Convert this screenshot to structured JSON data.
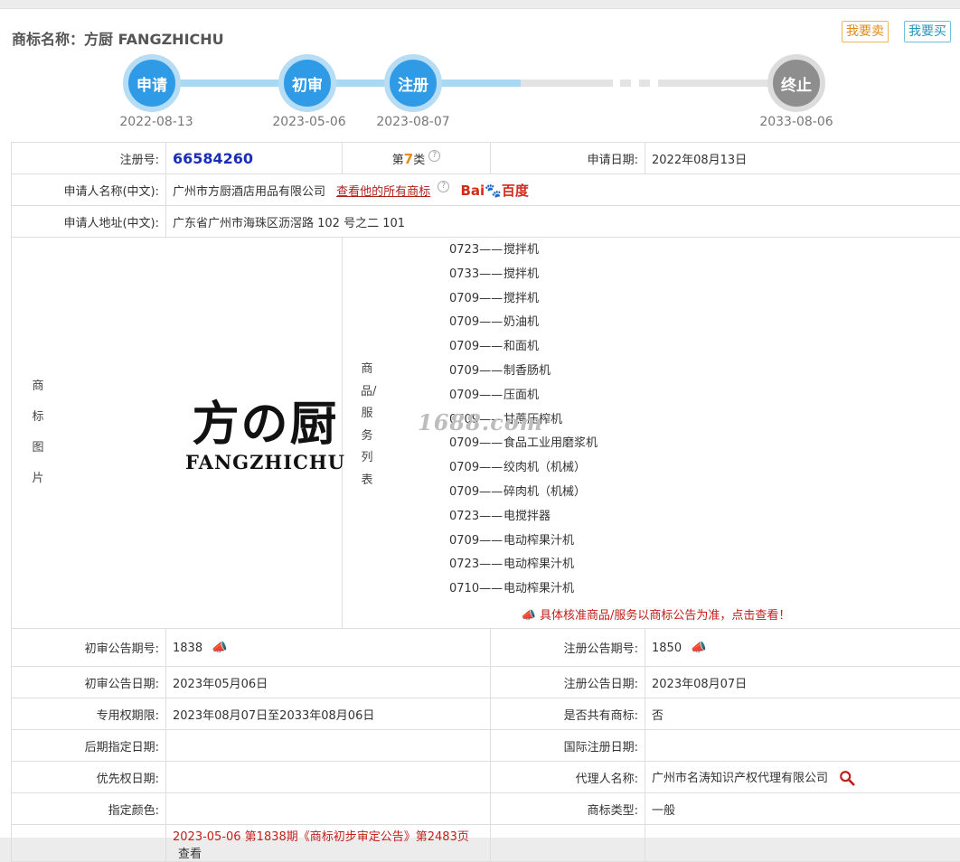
{
  "header": {
    "title": "商标名称：方厨 FANGZHICHU",
    "sell_label": "我要卖",
    "buy_label": "我要买"
  },
  "timeline": [
    {
      "label": "申请",
      "date": "2022-08-13"
    },
    {
      "label": "初审",
      "date": "2023-05-06"
    },
    {
      "label": "注册",
      "date": "2023-08-07"
    },
    {
      "label": "终止",
      "date": "2033-08-06"
    }
  ],
  "info": {
    "reg_no_label": "注册号:",
    "reg_no": "66584260",
    "class_prefix": "第",
    "class_num": "7",
    "class_suffix": "类",
    "apply_date_label": "申请日期:",
    "apply_date": "2022年08月13日",
    "applicant_label": "申请人名称(中文):",
    "applicant": "广州市方厨酒店用品有限公司",
    "view_all_link": "查看他的所有商标",
    "baidu_logo_text": "Bai百度",
    "address_label": "申请人地址(中文):",
    "address": "广东省广州市海珠区沥滘路 102 号之二 101",
    "image_label": "商标图片",
    "logo_cn": "方の厨",
    "logo_en": "FANGZHICHU",
    "watermark": "1688.com",
    "goods_label": "商品/服务列表",
    "goods": [
      {
        "code": "0723——",
        "name": "搅拌机"
      },
      {
        "code": "0733——",
        "name": "搅拌机"
      },
      {
        "code": "0709——",
        "name": "搅拌机"
      },
      {
        "code": "0709——",
        "name": "奶油机"
      },
      {
        "code": "0709——",
        "name": "和面机"
      },
      {
        "code": "0709——",
        "name": "制香肠机"
      },
      {
        "code": "0709——",
        "name": "压面机"
      },
      {
        "code": "0709——",
        "name": "甘蔗压榨机"
      },
      {
        "code": "0709——",
        "name": "食品工业用磨浆机"
      },
      {
        "code": "0709——",
        "name": "绞肉机（机械）"
      },
      {
        "code": "0709——",
        "name": "碎肉机（机械）"
      },
      {
        "code": "0723——",
        "name": "电搅拌器"
      },
      {
        "code": "0709——",
        "name": "电动榨果汁机"
      },
      {
        "code": "0723——",
        "name": "电动榨果汁机"
      },
      {
        "code": "0710——",
        "name": "电动榨果汁机"
      }
    ],
    "goods_notice": "具体核准商品/服务以商标公告为准，点击查看！",
    "prelim_no_label": "初审公告期号:",
    "prelim_no": "1838",
    "reg_ann_no_label": "注册公告期号:",
    "reg_ann_no": "1850",
    "prelim_date_label": "初审公告日期:",
    "prelim_date": "2023年05月06日",
    "reg_ann_date_label": "注册公告日期:",
    "reg_ann_date": "2023年08月07日",
    "term_label": "专用权期限:",
    "term": "2023年08月07日至2033年08月06日",
    "shared_label": "是否共有商标:",
    "shared": "否",
    "later_label": "后期指定日期:",
    "later": "",
    "intl_label": "国际注册日期:",
    "intl": "",
    "priority_label": "优先权日期:",
    "priority": "",
    "agent_label": "代理人名称:",
    "agent": "广州市名涛知识产权代理有限公司",
    "color_label": "指定颜色:",
    "color": "",
    "type_label": "商标类型:",
    "type": "一般",
    "bottom_text": "2023-05-06 第1838期《商标初步审定公告》第2483页",
    "bottom_link": "查看"
  },
  "colors": {
    "timeline_blue": "#2f9be6",
    "timeline_gray": "#8e8e8e",
    "reg_no_blue": "#1a2fb6",
    "link_red": "#b2201e"
  }
}
